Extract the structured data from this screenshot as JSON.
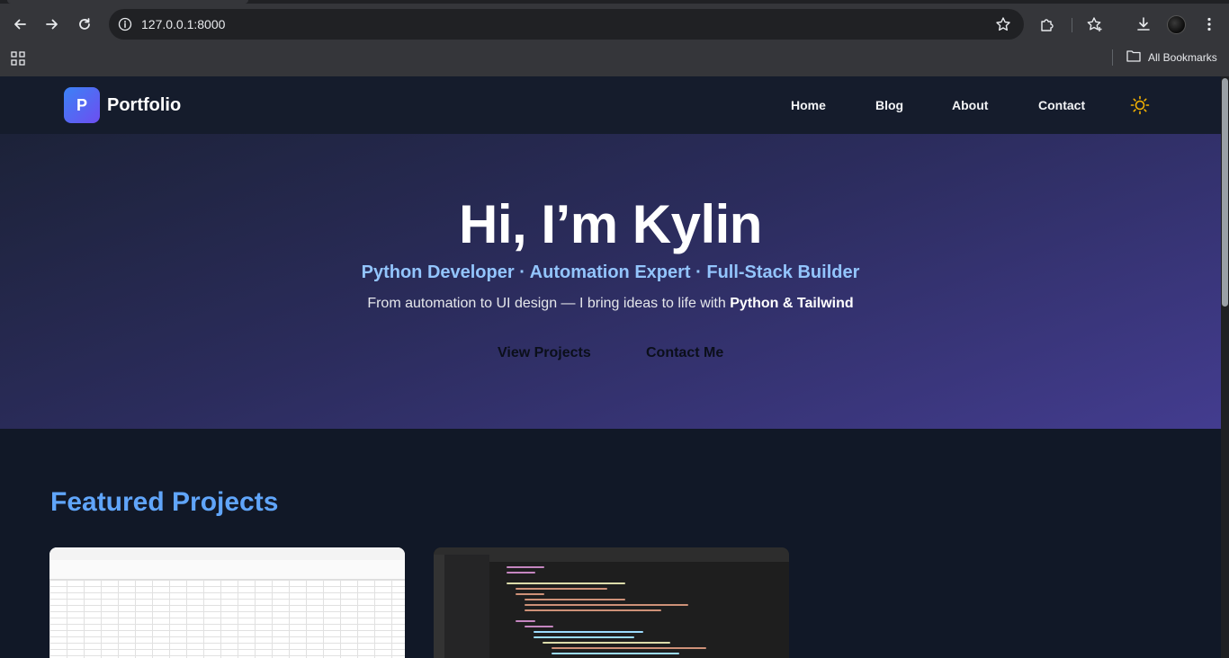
{
  "browser": {
    "url": "127.0.0.1:8000",
    "bookmarks_label": "All Bookmarks",
    "icons": [
      "back-icon",
      "forward-icon",
      "reload-icon",
      "site-info-icon",
      "bookmark-star-icon",
      "extensions-icon",
      "bookmarks-icon",
      "download-icon",
      "menu-icon",
      "apps-icon",
      "folder-icon"
    ]
  },
  "site": {
    "logo_letter": "P",
    "brand": "Portfolio",
    "nav": {
      "home": "Home",
      "blog": "Blog",
      "about": "About",
      "contact": "Contact"
    },
    "theme_icon": "sun-icon",
    "accent": "#60a5fa"
  },
  "hero": {
    "title": "Hi, I’m Kylin",
    "subtitle": "Python Developer · Automation Expert · Full-Stack Builder",
    "desc_prefix": "From automation to UI design — I bring ideas to life with ",
    "desc_python": "Python",
    "desc_amp": " & ",
    "desc_tailwind": "Tailwind",
    "btn_projects": "View Projects",
    "btn_contact": "Contact Me"
  },
  "featured": {
    "title": "Featured Projects"
  }
}
